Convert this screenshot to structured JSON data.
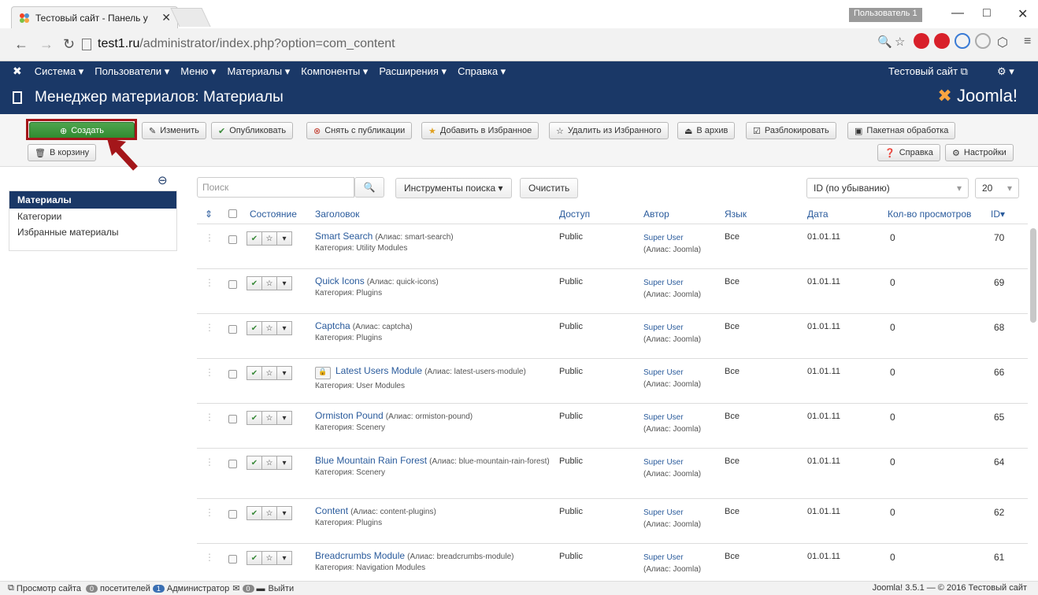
{
  "browser": {
    "tab_title": "Тестовый сайт - Панель у",
    "tab_close": "✕",
    "user_badge": "Пользователь 1",
    "url_host": "test1.ru",
    "url_path": "/administrator/index.php?option=com_content",
    "minimize": "—",
    "maximize": "□",
    "close": "✕"
  },
  "topmenu": {
    "items": [
      "Система ▾",
      "Пользователи ▾",
      "Меню ▾",
      "Материалы ▾",
      "Компоненты ▾",
      "Расширения ▾",
      "Справка ▾"
    ],
    "site_link": "Тестовый сайт ⧉",
    "gear": "⚙ ▾"
  },
  "header": {
    "title": "Менеджер материалов: Материалы",
    "brand": "Joomla!"
  },
  "toolbar": {
    "create": "Создать",
    "edit": "Изменить",
    "publish": "Опубликовать",
    "unpublish": "Снять с публикации",
    "feature": "Добавить в Избранное",
    "unfeature": "Удалить из Избранного",
    "archive": "В архив",
    "checkin": "Разблокировать",
    "batch": "Пакетная обработка",
    "trash": "В корзину",
    "help": "Справка",
    "options": "Настройки"
  },
  "sidebar": {
    "items": [
      "Материалы",
      "Категории",
      "Избранные материалы"
    ]
  },
  "filters": {
    "search_placeholder": "Поиск",
    "search_tools": "Инструменты поиска ▾",
    "clear": "Очистить",
    "ordering": "ID (по убыванию)",
    "limit": "20"
  },
  "table": {
    "headers": {
      "state": "Состояние",
      "title": "Заголовок",
      "access": "Доступ",
      "author": "Автор",
      "language": "Язык",
      "date": "Дата",
      "hits": "Кол-во просмотров",
      "id": "ID▾"
    },
    "rows": [
      {
        "title": "Smart Search",
        "alias": "(Алиас: smart-search)",
        "category": "Категория: Utility Modules",
        "access": "Public",
        "author": "Super User",
        "author_alias": "(Алиас: Joomla)",
        "language": "Все",
        "date": "01.01.11",
        "hits": "0",
        "id": "70"
      },
      {
        "title": "Quick Icons",
        "alias": "(Алиас: quick-icons)",
        "category": "Категория: Plugins",
        "access": "Public",
        "author": "Super User",
        "author_alias": "(Алиас: Joomla)",
        "language": "Все",
        "date": "01.01.11",
        "hits": "0",
        "id": "69"
      },
      {
        "title": "Captcha",
        "alias": "(Алиас: captcha)",
        "category": "Категория: Plugins",
        "access": "Public",
        "author": "Super User",
        "author_alias": "(Алиас: Joomla)",
        "language": "Все",
        "date": "01.01.11",
        "hits": "0",
        "id": "68"
      },
      {
        "title": "Latest Users Module",
        "alias": "(Алиас: latest-users-module)",
        "category": "Категория: User Modules",
        "access": "Public",
        "author": "Super User",
        "author_alias": "(Алиас: Joomla)",
        "language": "Все",
        "date": "01.01.11",
        "hits": "0",
        "id": "66"
      },
      {
        "title": "Ormiston Pound",
        "alias": "(Алиас: ormiston-pound)",
        "category": "Категория: Scenery",
        "access": "Public",
        "author": "Super User",
        "author_alias": "(Алиас: Joomla)",
        "language": "Все",
        "date": "01.01.11",
        "hits": "0",
        "id": "65"
      },
      {
        "title": "Blue Mountain Rain Forest",
        "alias": "(Алиас: blue-mountain-rain-forest)",
        "category": "Категория: Scenery",
        "access": "Public",
        "author": "Super User",
        "author_alias": "(Алиас: Joomla)",
        "language": "Все",
        "date": "01.01.11",
        "hits": "0",
        "id": "64"
      },
      {
        "title": "Content",
        "alias": "(Алиас: content-plugins)",
        "category": "Категория: Plugins",
        "access": "Public",
        "author": "Super User",
        "author_alias": "(Алиас: Joomla)",
        "language": "Все",
        "date": "01.01.11",
        "hits": "0",
        "id": "62"
      },
      {
        "title": "Breadcrumbs Module",
        "alias": "(Алиас: breadcrumbs-module)",
        "category": "Категория: Navigation Modules",
        "access": "Public",
        "author": "Super User",
        "author_alias": "(Алиас: Joomla)",
        "language": "Все",
        "date": "01.01.11",
        "hits": "0",
        "id": "61"
      }
    ]
  },
  "footer": {
    "view_site": "Просмотр сайта",
    "visitors_count": "0",
    "visitors": "посетителей",
    "admins_count": "1",
    "admins": "Администратор",
    "messages_count": "0",
    "logout": "Выйти",
    "version": "Joomla! 3.5.1 — © 2016 Тестовый сайт"
  },
  "colors": {
    "navy": "#1a3867",
    "green": "#3a973a",
    "link": "#2a5b9c",
    "highlight": "#a4161a"
  }
}
